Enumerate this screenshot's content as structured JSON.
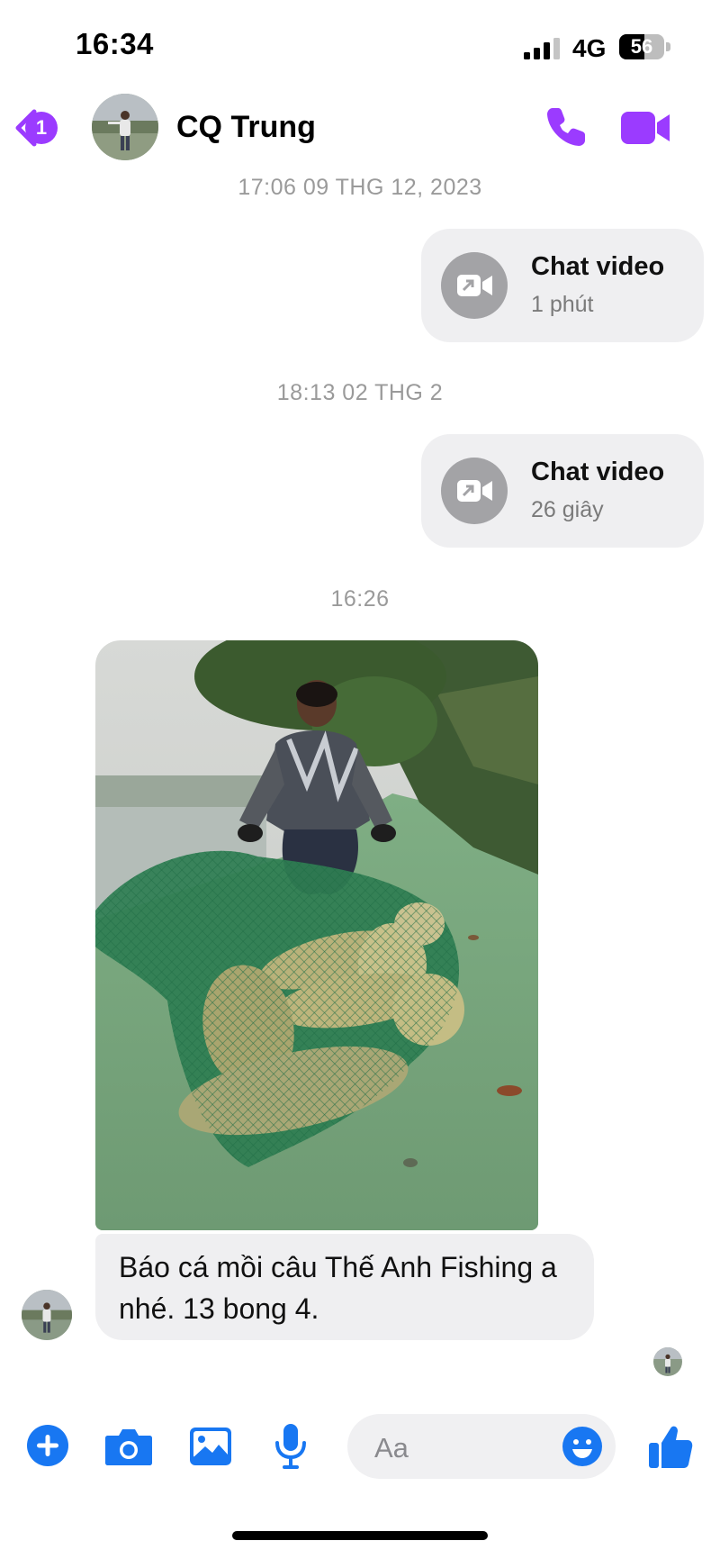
{
  "status_bar": {
    "time": "16:34",
    "network": "4G",
    "battery_level": "56"
  },
  "header": {
    "unread_count": "1",
    "contact_name": "CQ Trung",
    "accent_color": "#9b3bff"
  },
  "messages": [
    {
      "kind": "timestamp",
      "text": "17:06 09 THG 12, 2023"
    },
    {
      "kind": "call",
      "title": "Chat video",
      "duration": "1 phút"
    },
    {
      "kind": "timestamp",
      "text": "18:13 02 THG 2"
    },
    {
      "kind": "call",
      "title": "Chat video",
      "duration": "26 giây"
    },
    {
      "kind": "timestamp",
      "text": "16:26"
    },
    {
      "kind": "photo",
      "icon": "fishing-photo"
    },
    {
      "kind": "text",
      "text": "Báo cá mồi câu Thế Anh Fishing a nhé. 13 bong 4."
    }
  ],
  "composer": {
    "placeholder": "Aa",
    "brand_color": "#1877f2"
  }
}
